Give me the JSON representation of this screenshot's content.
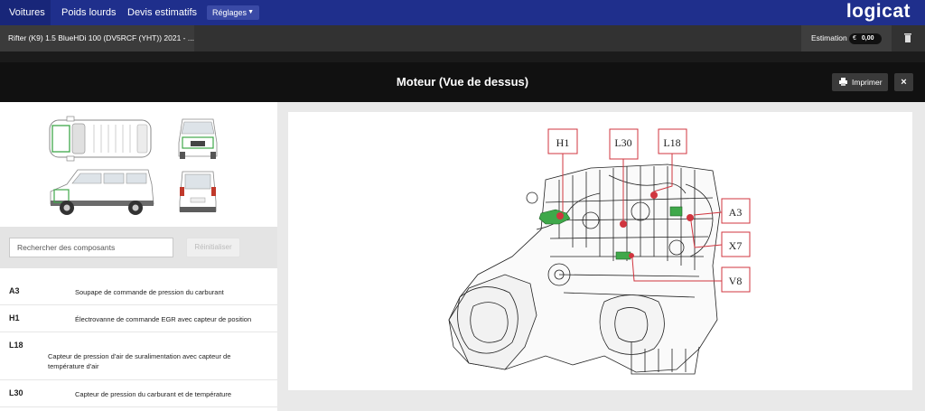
{
  "nav": {
    "items": [
      "Voitures",
      "Poids lourds",
      "Devis estimatifs"
    ],
    "settings_label": "Réglages",
    "logo": "logicat"
  },
  "vehicle": {
    "title": "Rifter (K9) 1.5 BlueHDi 100 (DV5RCF (YHT)) 2021 - ...",
    "estimation_label": "Estimation",
    "currency": "€",
    "estimation_value": "0,00"
  },
  "page": {
    "title": "Moteur (Vue de dessus)",
    "print_label": "Imprimer",
    "close_label": "×"
  },
  "search": {
    "placeholder": "Rechercher des composants",
    "reset_label": "Réinitialiser"
  },
  "components": [
    {
      "code": "A3",
      "description": "Soupape de commande de pression du carburant"
    },
    {
      "code": "H1",
      "description": "Électrovanne de commande EGR avec capteur de position"
    },
    {
      "code": "L18",
      "description": "Capteur de pression d'air de suralimentation avec capteur de température d'air"
    },
    {
      "code": "L30",
      "description": "Capteur de pression du carburant et de température"
    }
  ],
  "diagram_labels": [
    "H1",
    "L30",
    "L18",
    "A3",
    "X7",
    "V8"
  ],
  "colors": {
    "nav_bg": "#1f2f8c",
    "highlight_green": "#3fa84a",
    "marker_red": "#d0353f"
  }
}
